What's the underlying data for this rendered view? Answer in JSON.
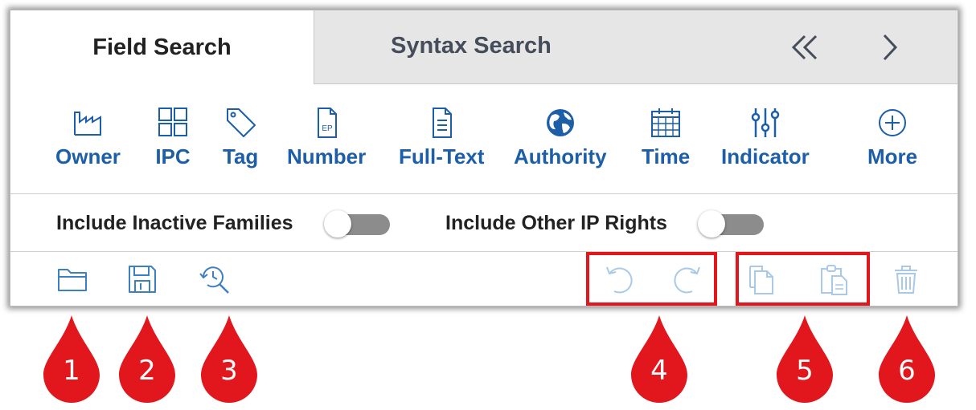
{
  "tabs": {
    "field_search": "Field Search",
    "syntax_search": "Syntax Search"
  },
  "nav": {
    "collapse_icon": "double-chevron-left-icon",
    "next_icon": "chevron-right-icon"
  },
  "fields": [
    {
      "label": "Owner",
      "icon": "factory-icon"
    },
    {
      "label": "IPC",
      "icon": "grid-icon"
    },
    {
      "label": "Tag",
      "icon": "tag-icon"
    },
    {
      "label": "Number",
      "icon": "ep-document-icon",
      "icon_text": "EP"
    },
    {
      "label": "Full-Text",
      "icon": "text-document-icon"
    },
    {
      "label": "Authority",
      "icon": "globe-icon"
    },
    {
      "label": "Time",
      "icon": "calendar-icon"
    },
    {
      "label": "Indicator",
      "icon": "sliders-icon"
    },
    {
      "label": "More",
      "icon": "plus-circle-icon"
    }
  ],
  "toggles": [
    {
      "label": "Include Inactive Families",
      "on": false
    },
    {
      "label": "Include Other IP Rights",
      "on": false
    }
  ],
  "toolbar": [
    "open-folder-icon",
    "save-icon",
    "history-search-icon",
    "undo-icon",
    "redo-icon",
    "copy-icon",
    "paste-icon",
    "trash-icon"
  ],
  "callouts": [
    "1",
    "2",
    "3",
    "4",
    "5",
    "6"
  ],
  "colors": {
    "accent": "#1c5ea8",
    "toolbar_icon": "#3c7fc2",
    "disabled_icon": "#a9c9e6",
    "callout": "#e2171e"
  }
}
